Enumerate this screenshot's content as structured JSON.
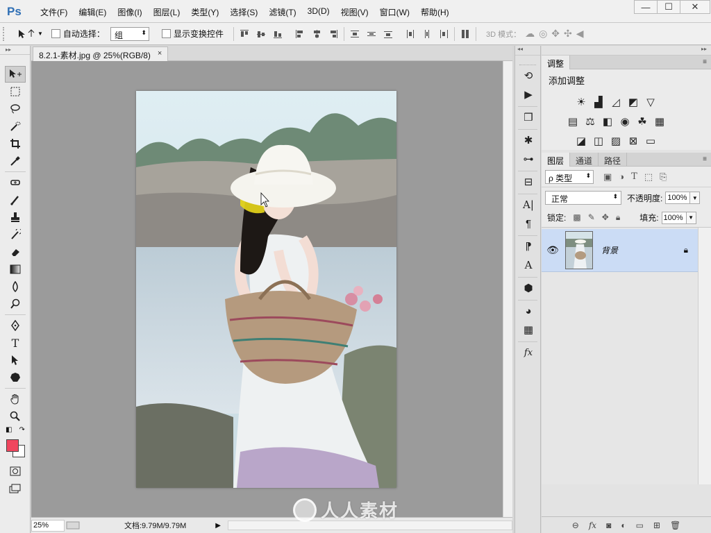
{
  "app": {
    "logo": "Ps"
  },
  "menu": [
    "文件(F)",
    "编辑(E)",
    "图像(I)",
    "图层(L)",
    "类型(Y)",
    "选择(S)",
    "滤镜(T)",
    "3D(D)",
    "视图(V)",
    "窗口(W)",
    "帮助(H)"
  ],
  "window_controls": {
    "minimize": "—",
    "restore": "☐",
    "close": "✕"
  },
  "options": {
    "auto_select_label": "自动选择：",
    "auto_select_value": "组",
    "show_transform_label": "显示变换控件",
    "mode3d_label": "3D 模式："
  },
  "document": {
    "tab_title": "8.2.1-素材.jpg @ 25%(RGB/8)",
    "tab_close": "×",
    "zoom": "25%",
    "doc_info": "文档:9.79M/9.79M",
    "status_arrow": "▶"
  },
  "colors": {
    "foreground": "#f0465e",
    "background": "#ffffff",
    "accent": "#2f6fb5",
    "layer_selected": "#cbdcf5",
    "canvas_bg": "#9b9b9b"
  },
  "adjustments": {
    "tab": "调整",
    "title": "添加调整"
  },
  "layers_panel": {
    "tabs": [
      "图层",
      "通道",
      "路径"
    ],
    "kind_filter": "ρ 类型",
    "blend_mode": "正常",
    "opacity_label": "不透明度:",
    "opacity_value": "100%",
    "lock_label": "锁定:",
    "fill_label": "填充:",
    "fill_value": "100%",
    "layers": [
      {
        "name": "背景",
        "visible": true,
        "locked": true
      }
    ]
  },
  "watermark": {
    "text": "人人素材"
  }
}
